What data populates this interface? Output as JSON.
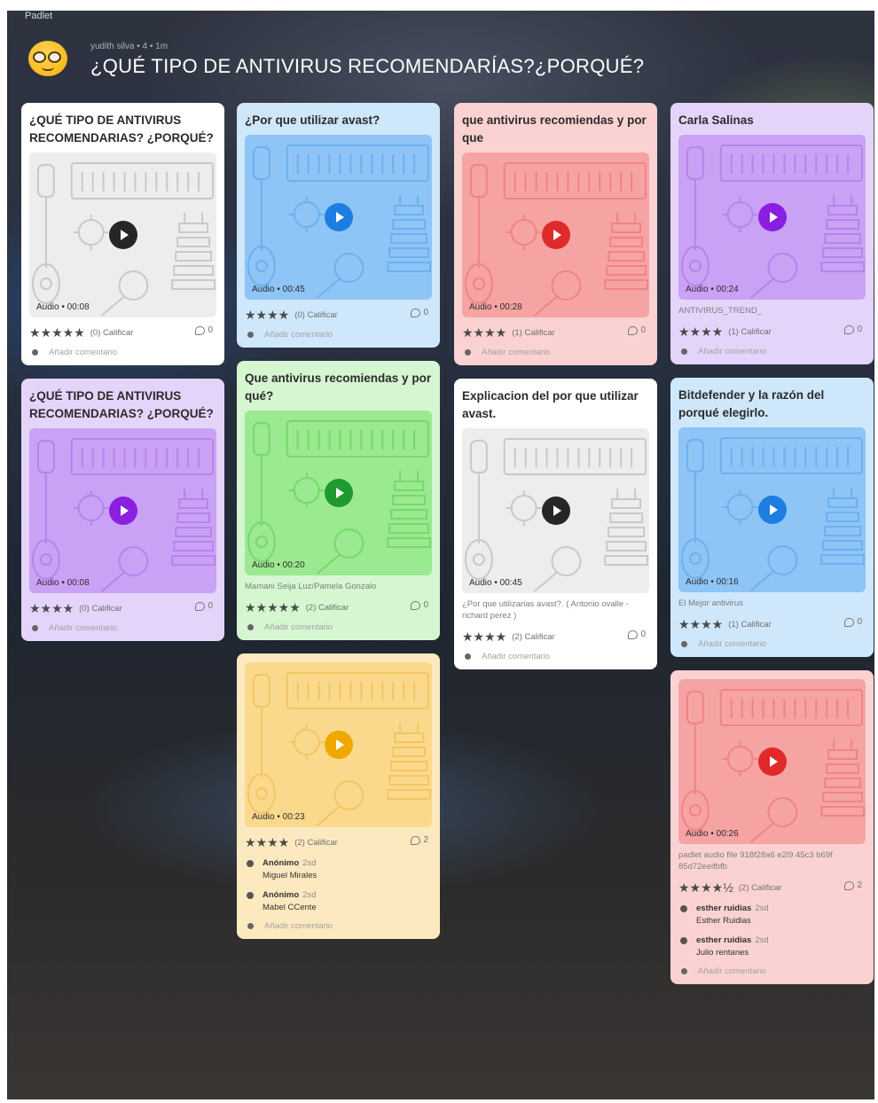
{
  "top_label": "Padlet",
  "header": {
    "meta": "yudith silva • 4 • 1m",
    "title": "¿QUÉ TIPO DE ANTIVIRUS RECOMENDARÍAS?¿PORQUÉ?"
  },
  "add_comment_label": "Añadir comentario",
  "calificar_label": "Calificar",
  "columns": [
    [
      {
        "color": "white",
        "title": "¿QUÉ TIPO DE ANTIVIRUS RECOMENDARIAS? ¿PORQUÉ?",
        "media": "Audio • 00:08",
        "desc": "",
        "stars": "★★★★★",
        "count": "(0)",
        "comments": "0",
        "comment_list": []
      },
      {
        "color": "purple",
        "title": "¿QUÉ TIPO DE ANTIVIRUS RECOMENDARIAS? ¿PORQUÉ?",
        "media": "Audio • 00:08",
        "desc": "",
        "stars": "★★★★",
        "count": "(0)",
        "comments": "0",
        "comment_list": []
      }
    ],
    [
      {
        "color": "blue",
        "title": "¿Por que utilizar avast?",
        "media": "Audio • 00:45",
        "desc": "",
        "stars": "★★★★",
        "count": "(0)",
        "comments": "0",
        "comment_list": []
      },
      {
        "color": "green",
        "title": "Que antivirus recomiendas y por qué?",
        "media": "Audio • 00:20",
        "desc": "Mamani Seija Luz/Pamela Gonzalo",
        "stars": "★★★★★",
        "count": "(2)",
        "comments": "0",
        "comment_list": []
      },
      {
        "color": "yellow",
        "title": "",
        "media": "Audio • 00:23",
        "desc": "",
        "stars": "★★★★",
        "count": "(2)",
        "comments": "2",
        "comment_list": [
          {
            "name": "Anónimo",
            "time": "2sd",
            "text": "Miguel Mirales"
          },
          {
            "name": "Anónimo",
            "time": "2sd",
            "text": "Mabel CCente"
          }
        ]
      }
    ],
    [
      {
        "color": "red",
        "title": "que antivirus recomiendas y por que",
        "media": "Audio • 00:28",
        "desc": "",
        "stars": "★★★★",
        "count": "(1)",
        "comments": "0",
        "comment_list": []
      },
      {
        "color": "white",
        "title": "Explicacion del por que utilizar avast.",
        "media": "Audio • 00:45",
        "desc": "¿Por que utilizarias avast?. ( Antonio ovalle - richard perez )",
        "stars": "★★★★",
        "count": "(2)",
        "comments": "0",
        "comment_list": []
      }
    ],
    [
      {
        "color": "purple",
        "title": "Carla Salinas",
        "media": "Audio • 00:24",
        "desc": "ANTIVIRUS_TREND_",
        "stars": "★★★★",
        "count": "(1)",
        "comments": "0",
        "comment_list": []
      },
      {
        "color": "blue",
        "title": "Bitdefender y la razón del porqué elegirlo.",
        "media": "Audio • 00:16",
        "desc": "El Mejor antivirus",
        "stars": "★★★★",
        "count": "(1)",
        "comments": "0",
        "comment_list": []
      },
      {
        "color": "red",
        "title": "",
        "media": "Audio • 00:26",
        "desc": "padlet audio file 918f28a6 e2l9 45c3 b69f 85d72eeifbfb",
        "stars": "★★★★½",
        "count": "(2)",
        "comments": "2",
        "comment_list": [
          {
            "name": "esther ruidias",
            "time": "2sd",
            "text": "Esther Ruidias"
          },
          {
            "name": "esther ruidias",
            "time": "2sd",
            "text": "Julio rentanes"
          }
        ]
      }
    ]
  ]
}
